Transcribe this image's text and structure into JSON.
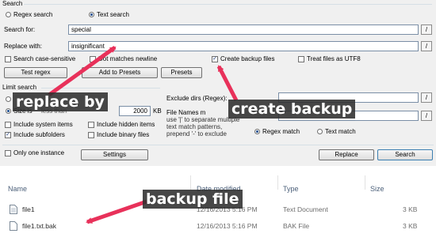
{
  "search_group": {
    "title": "Search",
    "regex_label": "Regex search",
    "text_label": "Text search",
    "search_for_label": "Search for:",
    "search_for_value": "special",
    "replace_with_label": "Replace with:",
    "replace_with_value": "insignificant",
    "pattern_button": "/",
    "case_sensitive_label": "Search case-sensitive",
    "dot_newline_label": "Dot matches newline",
    "backup_label": "Create backup files",
    "utf8_label": "Treat files as UTF8",
    "backup_checked": true,
    "test_regex_button": "Test regex",
    "add_presets_button": "Add to Presets",
    "presets_button": "Presets"
  },
  "limit_group": {
    "title": "Limit search",
    "size_label": "Size is",
    "size_cond": "less than",
    "size_value": "2000",
    "size_unit": "KB",
    "system_items_label": "Include system items",
    "hidden_items_label": "Include hidden items",
    "subfolders_label": "Include subfolders",
    "binary_files_label": "Include binary files",
    "subfolders_checked": true,
    "exclude_dirs_label": "Exclude dirs (Regex):",
    "file_names_label": "File Names m",
    "help_lines": [
      "use '|' to separate multiple",
      "text match patterns,",
      "prepend '-' to exclude"
    ],
    "regex_match_label": "Regex match",
    "text_match_label": "Text match"
  },
  "footer": {
    "one_instance_label": "Only one instance",
    "settings_button": "Settings",
    "replace_button": "Replace",
    "search_button": "Search"
  },
  "annotations": {
    "replace": "replace by",
    "backup": "create backup",
    "backup_file": "backup file"
  },
  "annotation_color": "#e8315a",
  "explorer": {
    "columns": {
      "name": "Name",
      "date": "Date modified",
      "type": "Type",
      "size": "Size"
    },
    "files": [
      {
        "name": "file1",
        "date": "12/16/2013 5:16 PM",
        "type": "Text Document",
        "size": "3 KB",
        "icon": "text-document-icon"
      },
      {
        "name": "file1.txt.bak",
        "date": "12/16/2013 5:16 PM",
        "type": "BAK File",
        "size": "3 KB",
        "icon": "bak-file-icon"
      }
    ]
  }
}
